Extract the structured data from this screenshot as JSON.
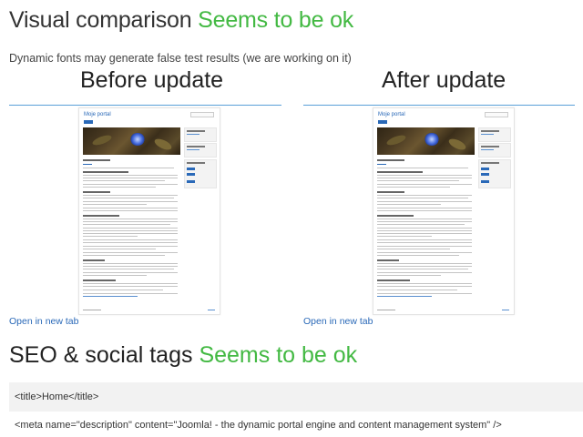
{
  "visual": {
    "heading": "Visual comparison",
    "status": "Seems to be ok",
    "note": "Dynamic fonts may generate false test results (we are working on it)",
    "before_title": "Before update",
    "after_title": "After update",
    "open_link": "Open in new tab",
    "colors": {
      "ok": "#43b943",
      "accent_line": "#5aa0d8",
      "link": "#2a69b8"
    }
  },
  "seo": {
    "heading": "SEO & social tags",
    "status": "Seems to be ok",
    "title_tag": "<title>Home</title>",
    "meta_description": "<meta name=\"description\" content=\"Joomla! - the dynamic portal engine and content management system\" />"
  }
}
